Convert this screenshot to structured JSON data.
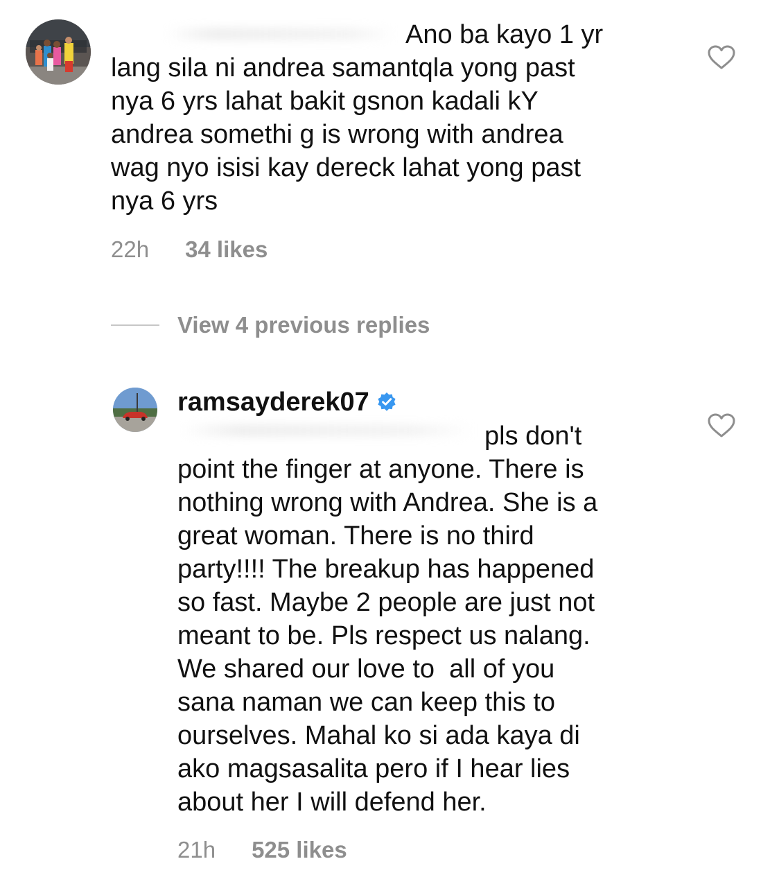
{
  "comments": [
    {
      "username": "",
      "text": "Ano ba kayo 1 yr\nlang sila ni andrea samantqla yong past\nnya 6 yrs lahat bakit gsnon kadali kY\nandrea somethi g is wrong with andrea\nwag nyo isisi kay dereck lahat yong past\nnya 6 yrs",
      "time": "22h",
      "likes": "34 likes",
      "liked": false
    },
    {
      "username": "ramsayderek07",
      "verified": true,
      "text": "pls don't\npoint the finger at anyone. There is\nnothing wrong with Andrea. She is a\ngreat woman. There is no third\nparty!!!! The breakup has happened\nso fast. Maybe 2 people are just not\nmeant to be. Pls respect us nalang.\nWe shared our love to  all of you\nsana naman we can keep this to\nourselves. Mahal ko si ada kaya di\nako magsasalita pero if I hear lies\nabout her I will defend her.",
      "time": "21h",
      "likes": "525 likes",
      "liked": false
    }
  ],
  "view_replies_label": "View 4 previous replies",
  "colors": {
    "text": "#111111",
    "secondary_text": "#8e8e8e",
    "verified_badge": "#3897f0",
    "heart_outline": "#8e8e8e"
  },
  "icons": {
    "like": "heart-outline-icon",
    "verified": "verified-badge-icon"
  }
}
